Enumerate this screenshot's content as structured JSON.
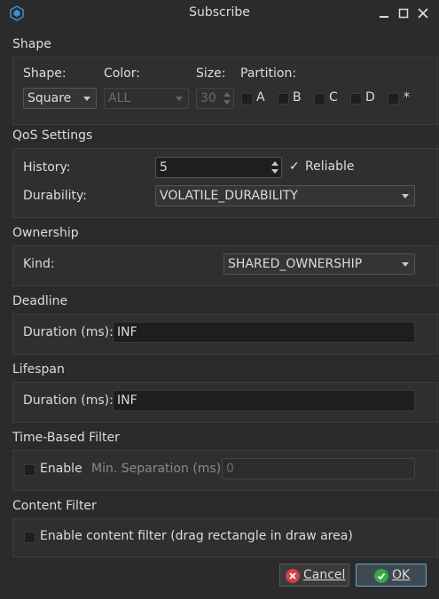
{
  "window": {
    "title": "Subscribe"
  },
  "shape_section": {
    "title": "Shape",
    "shape_label": "Shape:",
    "color_label": "Color:",
    "size_label": "Size:",
    "partition_label": "Partition:",
    "shape_value": "Square",
    "color_value": "ALL",
    "size_value": "30",
    "partitions": [
      "A",
      "B",
      "C",
      "D",
      "*"
    ]
  },
  "qos_section": {
    "title": "QoS Settings",
    "history_label": "History:",
    "history_value": "5",
    "reliable_label": "Reliable",
    "durability_label": "Durability:",
    "durability_value": "VOLATILE_DURABILITY"
  },
  "ownership_section": {
    "title": "Ownership",
    "kind_label": "Kind:",
    "kind_value": "SHARED_OWNERSHIP"
  },
  "deadline_section": {
    "title": "Deadline",
    "duration_label": "Duration (ms):",
    "duration_value": "INF"
  },
  "lifespan_section": {
    "title": "Lifespan",
    "duration_label": "Duration (ms):",
    "duration_value": "INF"
  },
  "time_filter_section": {
    "title": "Time-Based Filter",
    "enable_label": "Enable",
    "min_sep_label": "Min. Separation (ms):",
    "min_sep_value": "0"
  },
  "content_filter_section": {
    "title": "Content Filter",
    "enable_label": "Enable content filter (drag rectangle in draw area)"
  },
  "buttons": {
    "cancel": "Cancel",
    "ok": "OK"
  },
  "colors": {
    "background": "#2b2b2b",
    "group": "#2f2f2f",
    "accent": "#6aa6c8",
    "cancel_icon": "#d84040",
    "ok_icon": "#3aa84a"
  }
}
